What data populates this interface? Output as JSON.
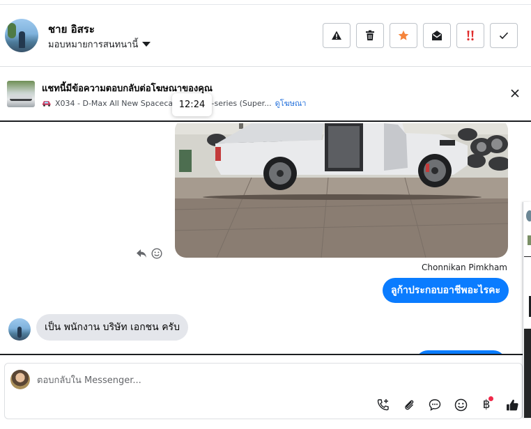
{
  "header": {
    "contact_name": "ชาย อิสระ",
    "assign_label": "มอบหมายการสนทนานี้",
    "actions": [
      {
        "name": "report-button",
        "icon": "warning-icon"
      },
      {
        "name": "delete-button",
        "icon": "trash-icon"
      },
      {
        "name": "star-button",
        "icon": "star-icon"
      },
      {
        "name": "mark-unread-button",
        "icon": "envelope-open-icon"
      },
      {
        "name": "flag-important-button",
        "icon": "exclamation-icon"
      },
      {
        "name": "mark-done-button",
        "icon": "check-icon"
      }
    ]
  },
  "ad_banner": {
    "title": "แชทนี้มีข้อความตอบกลับต่อโฆษณาของคุณ",
    "subtitle": "X034 - D-Max All New Spacecab Speed X-series (Super...",
    "link": "ดูโฆษณา"
  },
  "tooltip": {
    "time": "12:24"
  },
  "chat": {
    "sender_name": "Chonnikan Pimkham",
    "outgoing_message": "ลูก้าประกอบอาชีพอะไรคะ",
    "incoming_message": "เป็น พนักงาน บริษัท เอกชน ครับ"
  },
  "composer": {
    "placeholder": "ตอบกลับใน Messenger..."
  },
  "colors": {
    "messenger_blue": "#0a7cff",
    "incoming_gray": "#e4e6eb",
    "link_blue": "#216fdb",
    "star_orange": "#f5833a",
    "exclamation_red": "#e02e2e",
    "notification_dot": "#f02849"
  }
}
